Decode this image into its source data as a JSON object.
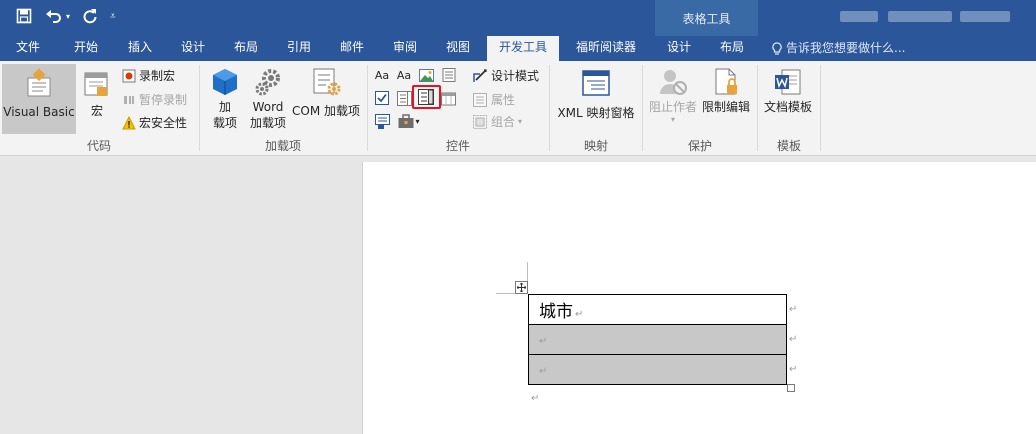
{
  "title_bar": {
    "context_title": "表格工具",
    "qat": {
      "save_icon": "save-icon",
      "undo_icon": "undo-icon",
      "redo_icon": "redo-icon",
      "customize_icon": "customize-qat-icon"
    }
  },
  "tabs": [
    {
      "label": "文件"
    },
    {
      "label": "开始"
    },
    {
      "label": "插入"
    },
    {
      "label": "设计"
    },
    {
      "label": "布局"
    },
    {
      "label": "引用"
    },
    {
      "label": "邮件"
    },
    {
      "label": "审阅"
    },
    {
      "label": "视图"
    },
    {
      "label": "开发工具"
    },
    {
      "label": "福昕阅读器"
    },
    {
      "label": "设计"
    },
    {
      "label": "布局"
    }
  ],
  "tell_me": "告诉我您想要做什么...",
  "ribbon": {
    "code": {
      "label": "代码",
      "visual_basic": "Visual Basic",
      "macros": "宏",
      "record_macro": "录制宏",
      "pause_recording": "暂停录制",
      "macro_security": "宏安全性"
    },
    "addins": {
      "label": "加载项",
      "addins_line1": "加",
      "addins_line2": "载项",
      "word_line1": "Word",
      "word_line2": "加载项",
      "com_addins": "COM 加载项"
    },
    "controls": {
      "label": "控件",
      "design_mode": "设计模式",
      "properties": "属性",
      "group": "组合"
    },
    "mapping": {
      "label": "映射",
      "xml_pane": "XML 映射窗格"
    },
    "protect": {
      "label": "保护",
      "block_authors": "阻止作者",
      "restrict_editing": "限制编辑"
    },
    "templates": {
      "label": "模板",
      "document_template": "文档模板"
    }
  },
  "document": {
    "table": {
      "rows": [
        {
          "text": "城市"
        },
        {
          "text": ""
        },
        {
          "text": ""
        }
      ]
    }
  },
  "colors": {
    "title_bar": "#2b579a",
    "highlight_box": "#e81123",
    "shaded_cell": "#c8c8c8"
  }
}
